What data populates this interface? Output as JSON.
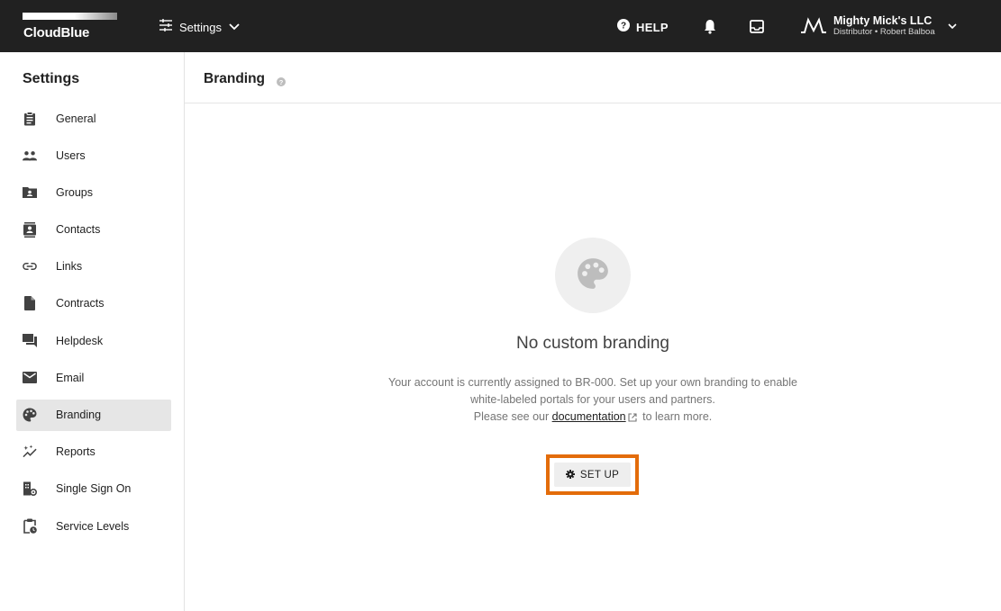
{
  "topbar": {
    "logo_text": "CloudBlue",
    "settings_menu_label": "Settings",
    "help_label": "HELP",
    "account_name": "Mighty Mick's LLC",
    "account_subtitle": "Distributor • Robert Balboa"
  },
  "sidebar": {
    "title": "Settings",
    "items": [
      {
        "label": "General",
        "icon": "clipboard-icon",
        "active": false
      },
      {
        "label": "Users",
        "icon": "users-icon",
        "active": false
      },
      {
        "label": "Groups",
        "icon": "folder-account-icon",
        "active": false
      },
      {
        "label": "Contacts",
        "icon": "contacts-icon",
        "active": false
      },
      {
        "label": "Links",
        "icon": "link-icon",
        "active": false
      },
      {
        "label": "Contracts",
        "icon": "file-icon",
        "active": false
      },
      {
        "label": "Helpdesk",
        "icon": "forum-icon",
        "active": false
      },
      {
        "label": "Email",
        "icon": "email-icon",
        "active": false
      },
      {
        "label": "Branding",
        "icon": "palette-icon",
        "active": true
      },
      {
        "label": "Reports",
        "icon": "sparkle-chart-icon",
        "active": false
      },
      {
        "label": "Single Sign On",
        "icon": "domain-gear-icon",
        "active": false
      },
      {
        "label": "Service Levels",
        "icon": "clipboard-clock-icon",
        "active": false
      }
    ]
  },
  "main": {
    "title": "Branding",
    "empty_title": "No custom branding",
    "desc_line1": "Your account is currently assigned to BR-000. Set up your own branding to enable",
    "desc_line2": "white-labeled portals for your users and partners.",
    "desc_line3_prefix": "Please see our",
    "desc_link": "documentation",
    "desc_line3_suffix": "to learn more.",
    "setup_label": "SET UP",
    "highlight_color": "#e36c0a"
  }
}
